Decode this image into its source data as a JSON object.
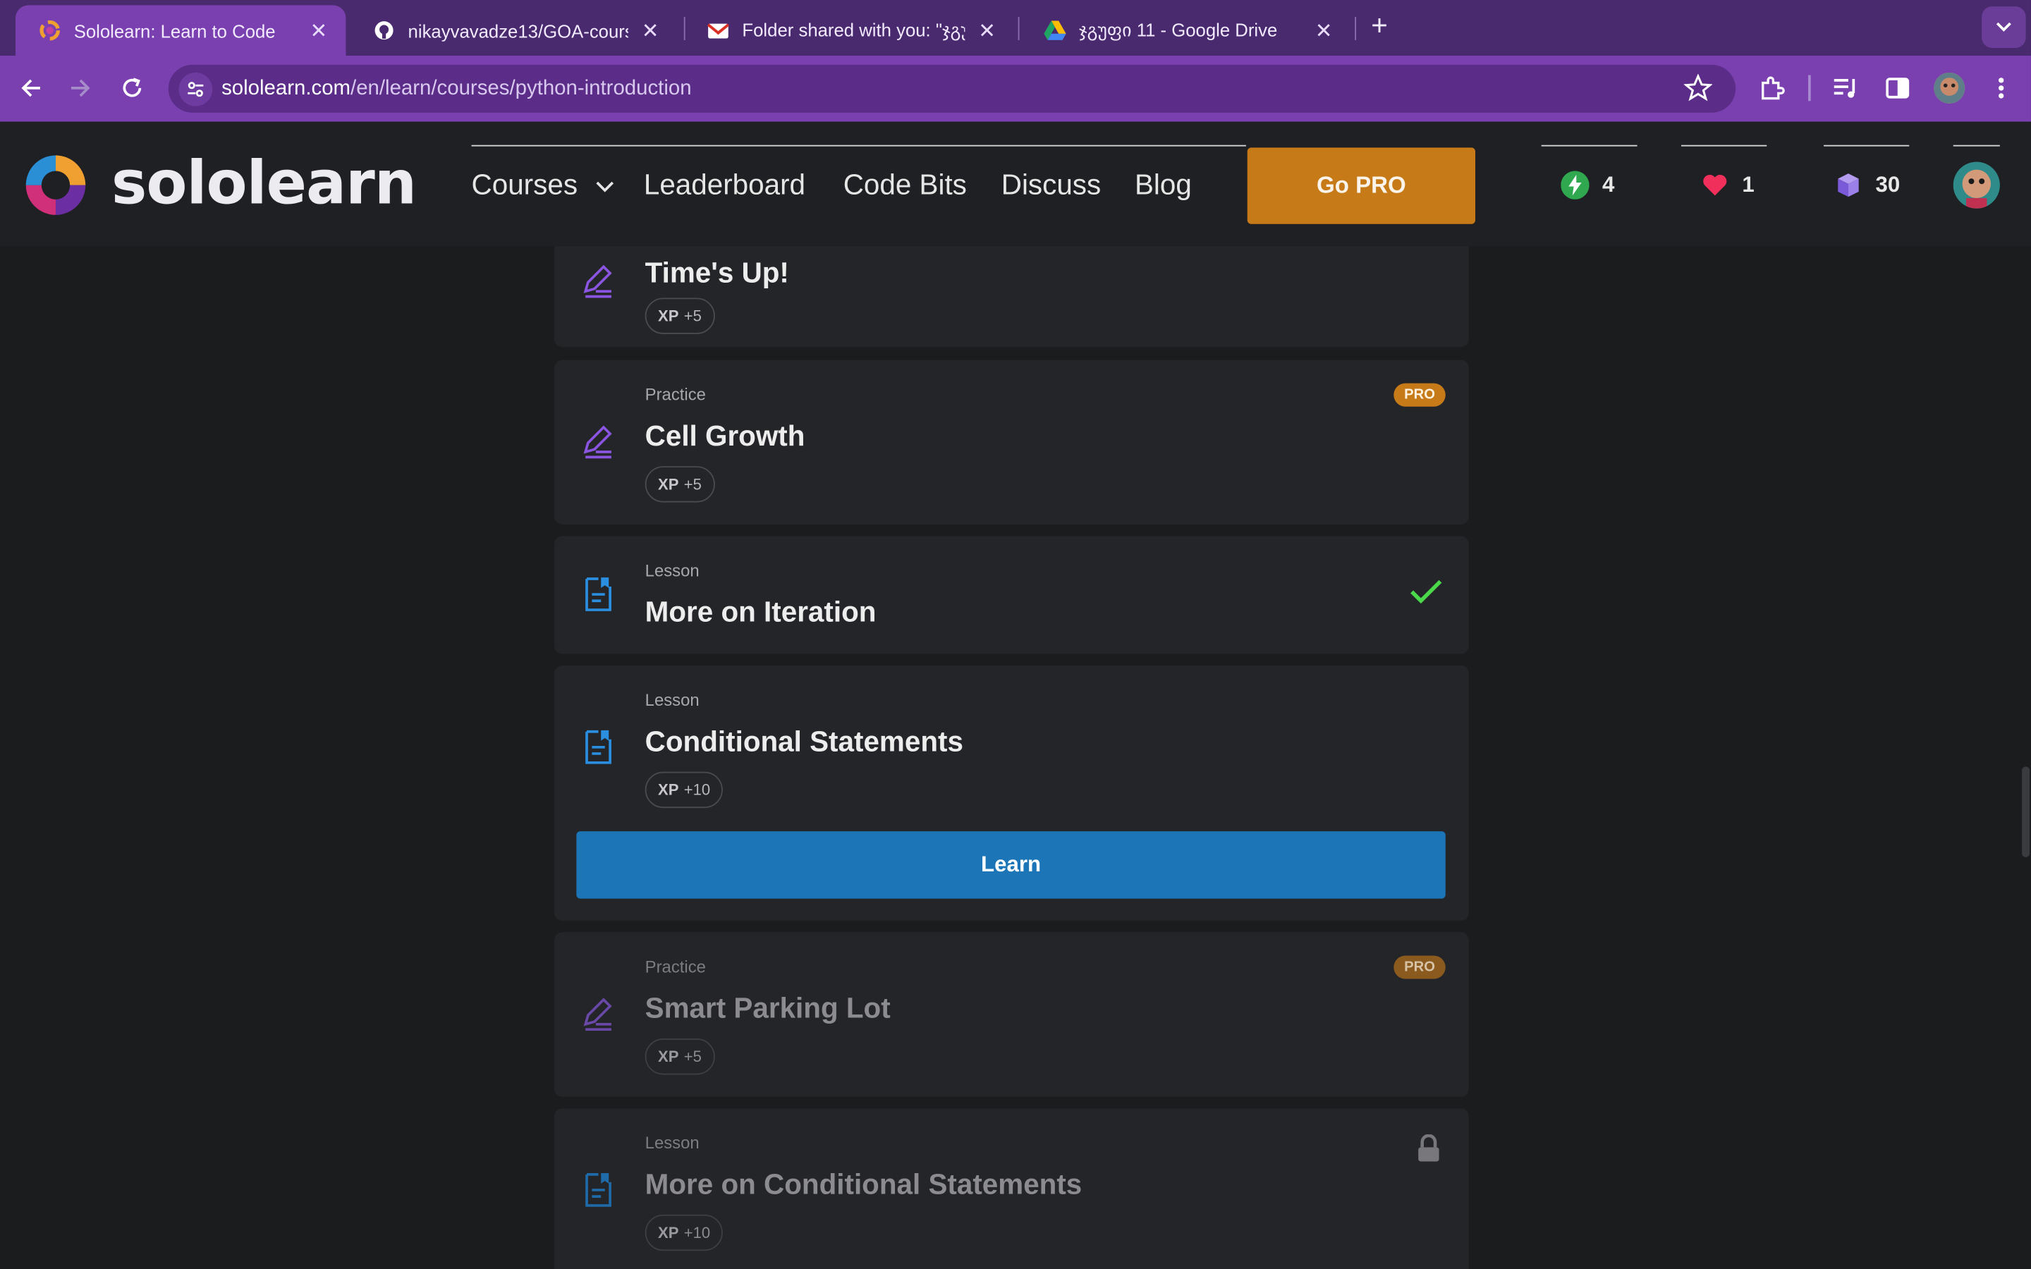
{
  "browser": {
    "tabs": [
      {
        "title": "Sololearn: Learn to Code",
        "icon": "sololearn-icon",
        "active": true
      },
      {
        "title": "nikayvavadze13/GOA-course",
        "icon": "github-icon",
        "active": false
      },
      {
        "title": "Folder shared with you: \"ჯგუ",
        "icon": "gmail-icon",
        "active": false
      },
      {
        "title": "ჯგუფი 11 - Google Drive",
        "icon": "google-drive-icon",
        "active": false
      }
    ],
    "url_host": "sololearn.com",
    "url_path": "/en/learn/courses/python-introduction"
  },
  "header": {
    "logo_text": "sololearn",
    "nav": {
      "courses": "Courses",
      "leaderboard": "Leaderboard",
      "code_bits": "Code Bits",
      "discuss": "Discuss",
      "blog": "Blog"
    },
    "go_pro": "Go PRO",
    "streak": "4",
    "hearts": "1",
    "bits": "30"
  },
  "colors": {
    "accent_purple": "#7a40b0",
    "go_pro": "#c77a18",
    "learn_button": "#1c75b7",
    "check_green": "#4ad94a"
  },
  "lessons": [
    {
      "kind": "",
      "name": "Time's Up!",
      "xp": "+5",
      "type": "practice"
    },
    {
      "kind": "Practice",
      "name": "Cell Growth",
      "xp": "+5",
      "badge": "PRO",
      "type": "practice"
    },
    {
      "kind": "Lesson",
      "name": "More on Iteration",
      "status": "completed",
      "type": "lesson"
    },
    {
      "kind": "Lesson",
      "name": "Conditional Statements",
      "xp": "+10",
      "action": "Learn",
      "type": "lesson"
    },
    {
      "kind": "Practice",
      "name": "Smart Parking Lot",
      "xp": "+5",
      "badge": "PRO",
      "type": "practice"
    },
    {
      "kind": "Lesson",
      "name": "More on Conditional Statements",
      "xp": "+10",
      "status": "locked",
      "type": "lesson"
    }
  ],
  "xp_label": "XP"
}
